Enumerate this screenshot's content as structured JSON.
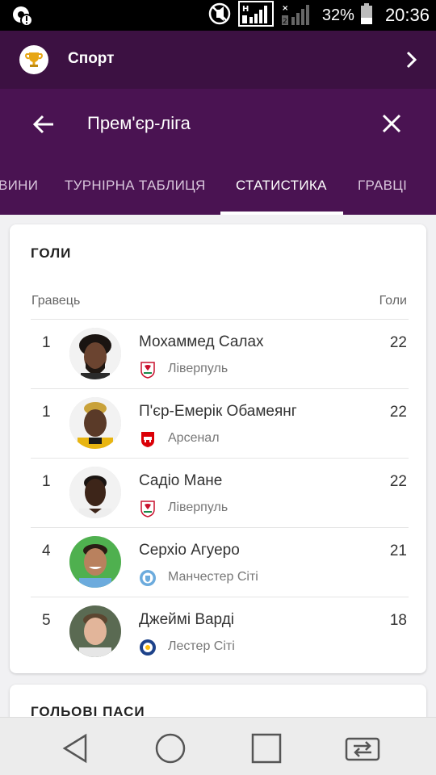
{
  "status_bar": {
    "battery": "32%",
    "time": "20:36"
  },
  "app_bar": {
    "title": "Спорт"
  },
  "search": {
    "query": "Прем'єр-ліга"
  },
  "tabs": [
    {
      "label": "ВИНИ"
    },
    {
      "label": "ТУРНІРНА ТАБЛИЦЯ"
    },
    {
      "label": "СТАТИСТИКА",
      "active": true
    },
    {
      "label": "ГРАВЦІ"
    }
  ],
  "goals_card": {
    "title": "ГОЛИ",
    "col_player": "Гравець",
    "col_goals": "Голи",
    "rows": [
      {
        "rank": "1",
        "name": "Мохаммед Салах",
        "club": "Ліверпуль",
        "goals": "22",
        "club_icon": "liverpool-crest"
      },
      {
        "rank": "1",
        "name": "П'єр-Емерік Обамеянг",
        "club": "Арсенал",
        "goals": "22",
        "club_icon": "arsenal-crest"
      },
      {
        "rank": "1",
        "name": "Садіо Мане",
        "club": "Ліверпуль",
        "goals": "22",
        "club_icon": "liverpool-crest"
      },
      {
        "rank": "4",
        "name": "Серхіо Агуеро",
        "club": "Манчестер Сіті",
        "goals": "21",
        "club_icon": "man-city-crest"
      },
      {
        "rank": "5",
        "name": "Джеймі Варді",
        "club": "Лестер Сіті",
        "goals": "18",
        "club_icon": "leicester-crest"
      }
    ]
  },
  "assists_card": {
    "title": "ГОЛЬОВІ ПАСИ"
  },
  "colors": {
    "app_bar": "#3c1142",
    "header": "#4a1352",
    "liverpool": "#c8102e",
    "arsenal": "#db0007",
    "man_city": "#6cabdd",
    "leicester": "#1d428a"
  }
}
